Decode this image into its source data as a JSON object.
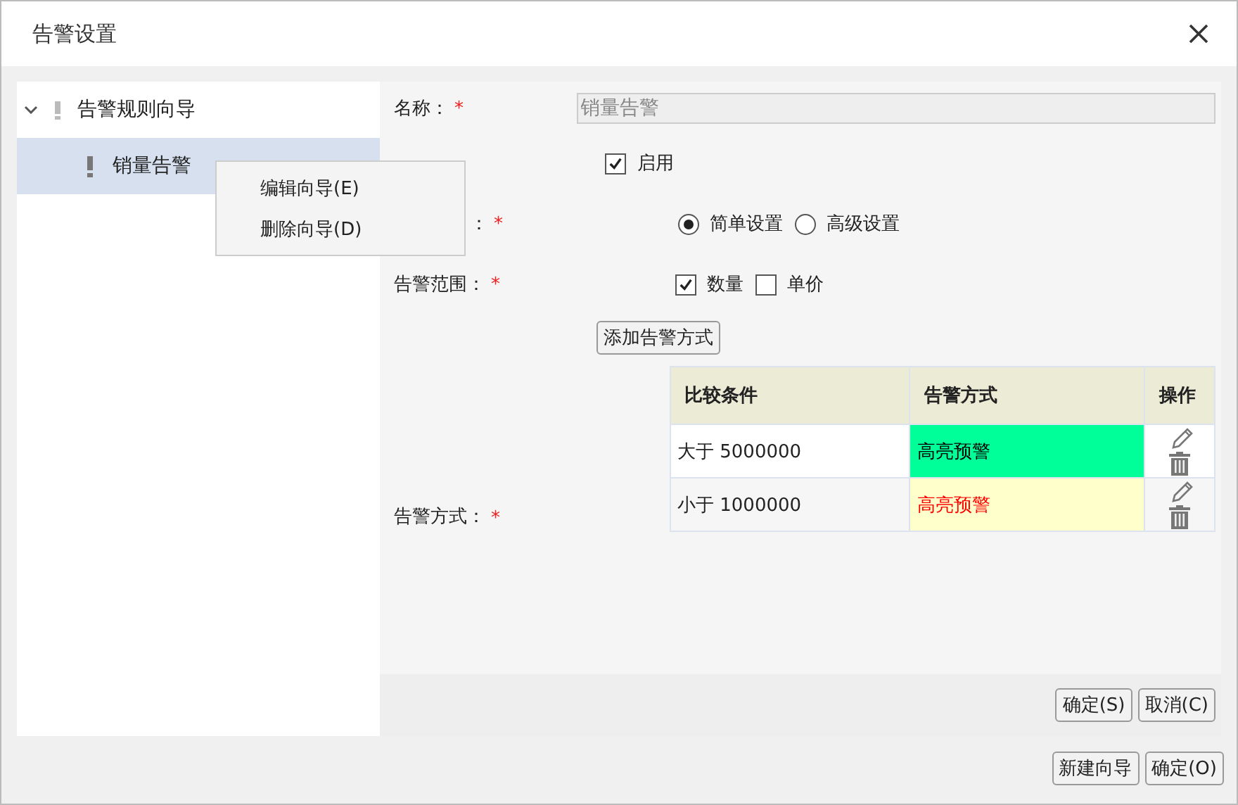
{
  "window": {
    "title": "告警设置"
  },
  "tree": [
    {
      "label": "告警规则向导",
      "expanded": true,
      "selected": false,
      "children": [
        {
          "label": "销量告警",
          "selected": true
        }
      ]
    }
  ],
  "context_menu": [
    "编辑向导(E)",
    "删除向导(D)"
  ],
  "form": {
    "name": {
      "label": "名称：",
      "required_mark": "*",
      "value": "销量告警"
    },
    "enabled": {
      "label": "启用",
      "checked": true
    },
    "type": {
      "label": "：",
      "required_mark": "*",
      "options": [
        {
          "label": "简单设置",
          "selected": true
        },
        {
          "label": "高级设置",
          "selected": false
        }
      ]
    },
    "scope": {
      "label": "告警范围：",
      "required_mark": "*",
      "options": [
        {
          "label": "数量",
          "checked": true
        },
        {
          "label": "单价",
          "checked": false
        }
      ]
    },
    "add_button": "添加告警方式",
    "method_label": {
      "label": "告警方式：",
      "required_mark": "*"
    },
    "table": {
      "columns": [
        "比较条件",
        "告警方式",
        "操作"
      ],
      "rows": [
        {
          "condition": "大于 5000000",
          "method": "高亮预警",
          "color": "#00ff99",
          "red_text": false
        },
        {
          "condition": "小于 1000000",
          "method": "高亮预警",
          "color": "#ffffcc",
          "red_text": true
        }
      ]
    }
  },
  "panel_buttons": [
    "确定(S)",
    "取消(C)"
  ],
  "footer_buttons": [
    "新建向导",
    "确定(O)"
  ]
}
